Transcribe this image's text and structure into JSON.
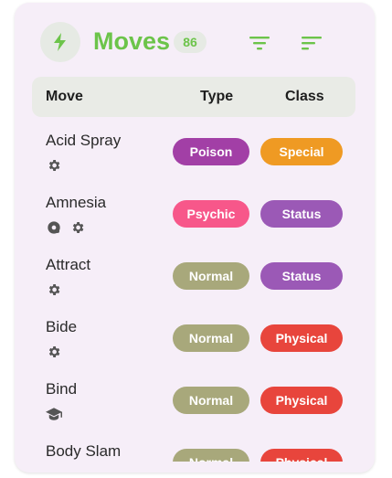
{
  "header": {
    "title": "Moves",
    "count": "86",
    "icons": [
      "bolt-icon",
      "filter-icon",
      "sort-icon"
    ]
  },
  "columns": {
    "move": "Move",
    "type": "Type",
    "class": "Class"
  },
  "colors": {
    "accent": "#6cc44a",
    "Poison": "#a23fa6",
    "Psychic": "#f7578a",
    "Normal": "#a8a87b",
    "Special": "#ef9a23",
    "Status": "#9b59b6",
    "Physical": "#e8453c"
  },
  "moves": [
    {
      "name": "Acid Spray",
      "type": "Poison",
      "class": "Special",
      "icons": [
        "gear-icon"
      ]
    },
    {
      "name": "Amnesia",
      "type": "Psychic",
      "class": "Status",
      "icons": [
        "disc-icon",
        "gear-icon"
      ]
    },
    {
      "name": "Attract",
      "type": "Normal",
      "class": "Status",
      "icons": [
        "gear-icon"
      ]
    },
    {
      "name": "Bide",
      "type": "Normal",
      "class": "Physical",
      "icons": [
        "gear-icon"
      ]
    },
    {
      "name": "Bind",
      "type": "Normal",
      "class": "Physical",
      "icons": [
        "graduation-cap-icon"
      ]
    },
    {
      "name": "Body Slam",
      "type": "Normal",
      "class": "Physical",
      "icons": []
    }
  ]
}
